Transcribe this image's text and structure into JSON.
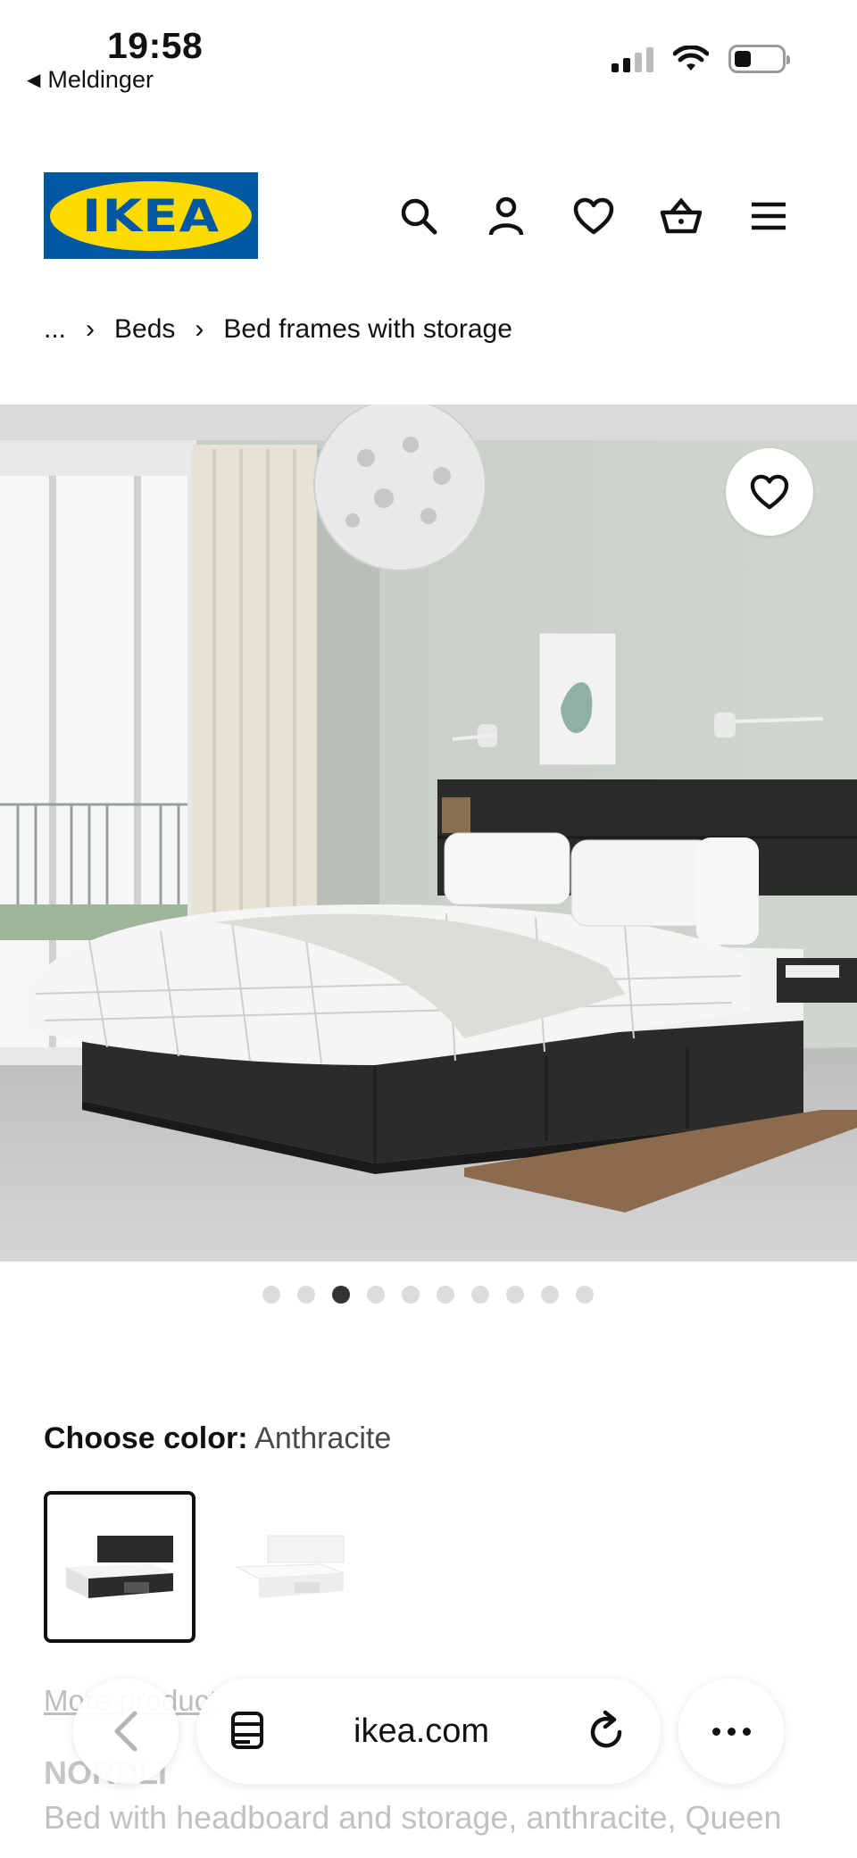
{
  "status_bar": {
    "time": "19:58",
    "back_app": "Meldinger"
  },
  "header": {
    "logo_text": "IKEA",
    "brand_colors": {
      "blue": "#0058a3",
      "yellow": "#ffdb00"
    },
    "icons": [
      "search-icon",
      "user-icon",
      "heart-icon",
      "basket-icon",
      "menu-icon"
    ]
  },
  "breadcrumb": {
    "items": [
      "...",
      "Beds",
      "Bed frames with storage"
    ],
    "separator": "›"
  },
  "gallery": {
    "image_count": 10,
    "active_index": 2
  },
  "color": {
    "label": "Choose color:",
    "value": "Anthracite",
    "swatches": [
      "Anthracite",
      "White"
    ]
  },
  "product": {
    "more_link": "More product",
    "name": "NORDLI",
    "description": "Bed with headboard and storage, anthracite, Queen"
  },
  "browser": {
    "url": "ikea.com"
  }
}
